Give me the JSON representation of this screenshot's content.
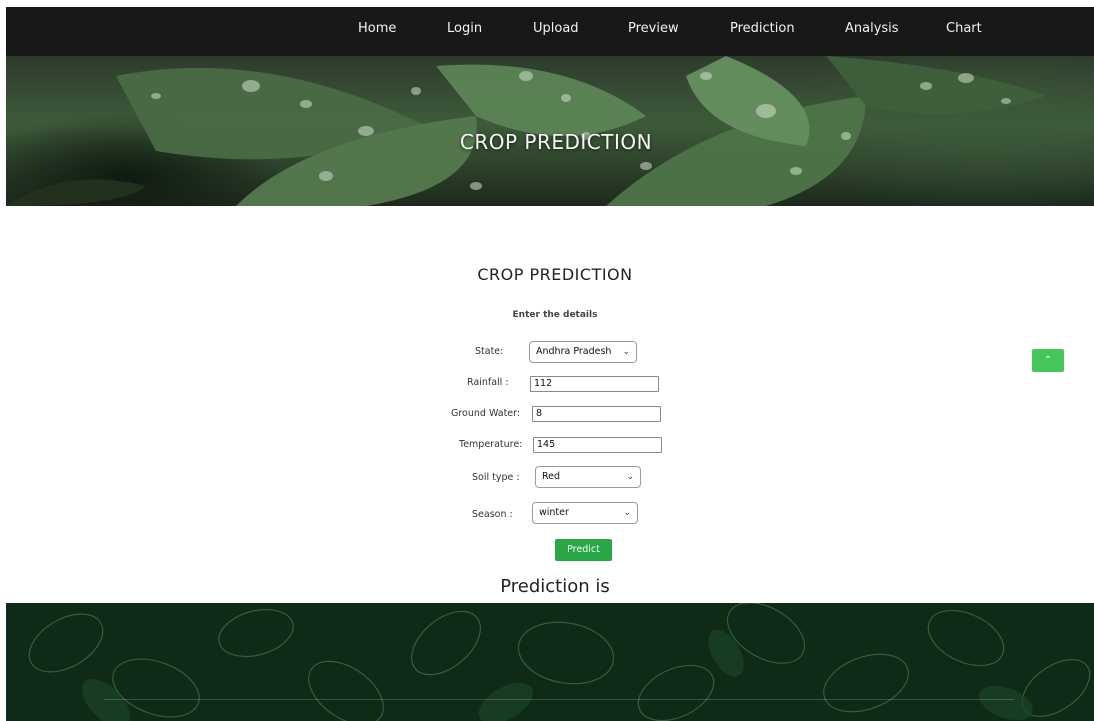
{
  "nav": {
    "items": [
      "Home",
      "Login",
      "Upload",
      "Preview",
      "Prediction",
      "Analysis",
      "Chart"
    ]
  },
  "hero": {
    "title": "CROP PREDICTION"
  },
  "form": {
    "title": "CROP PREDICTION",
    "subtitle": "Enter the details",
    "state": {
      "label": "State:",
      "value": "Andhra Pradesh"
    },
    "rainfall": {
      "label": "Rainfall :",
      "value": "112"
    },
    "ground_water": {
      "label": "Ground Water:",
      "value": "8"
    },
    "temperature": {
      "label": "Temperature:",
      "value": "145"
    },
    "soil_type": {
      "label": "Soil type :",
      "value": "Red"
    },
    "season": {
      "label": "Season :",
      "value": "winter"
    },
    "predict_label": "Predict"
  },
  "result": {
    "text": "Prediction is"
  },
  "colors": {
    "nav_bg": "#181818",
    "button_green": "#28a745",
    "scroll_button": "#43c65a",
    "footer_bg": "#0f2a16"
  }
}
